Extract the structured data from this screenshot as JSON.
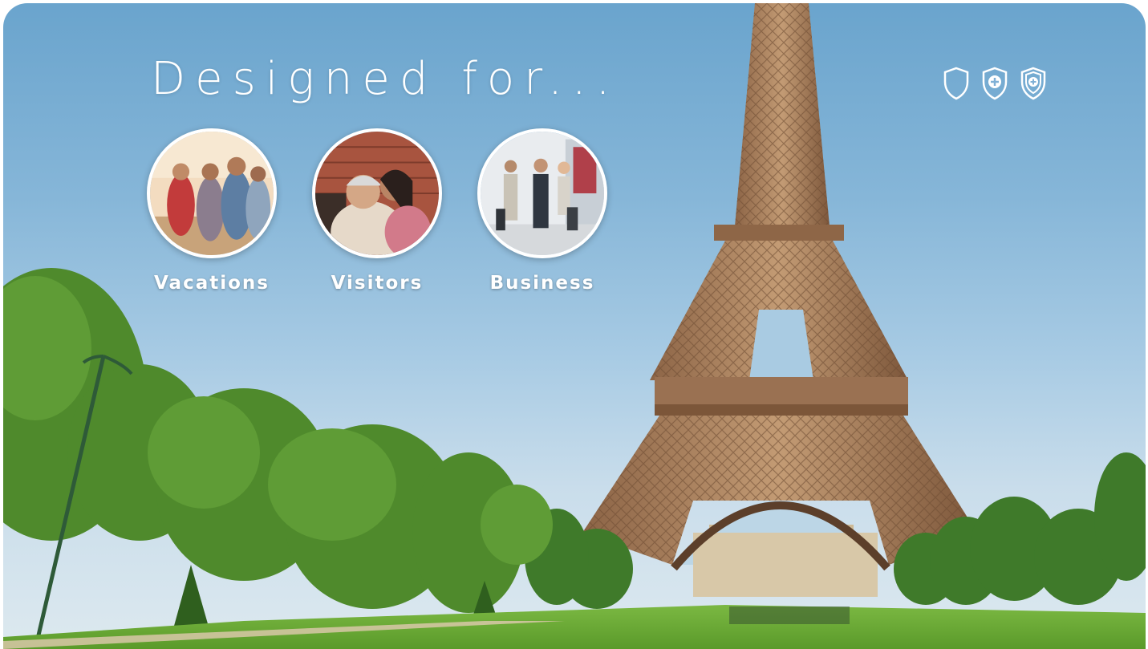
{
  "hero": {
    "headline": "Designed for...",
    "background": "eiffel-tower-park-photo"
  },
  "badges": [
    {
      "icon": "shield-outline-icon"
    },
    {
      "icon": "shield-plus-icon"
    },
    {
      "icon": "shield-double-plus-icon"
    }
  ],
  "audiences": [
    {
      "label": "Vacations",
      "image": "group-of-friends-photo"
    },
    {
      "label": "Visitors",
      "image": "grandmother-and-granddaughter-photo"
    },
    {
      "label": "Business",
      "image": "business-travelers-photo"
    }
  ],
  "colors": {
    "sky_top": "#6aa4cd",
    "tower": "#b58a62",
    "foliage": "#4f8a2c",
    "lawn": "#6fae3a",
    "text": "#ffffff"
  }
}
